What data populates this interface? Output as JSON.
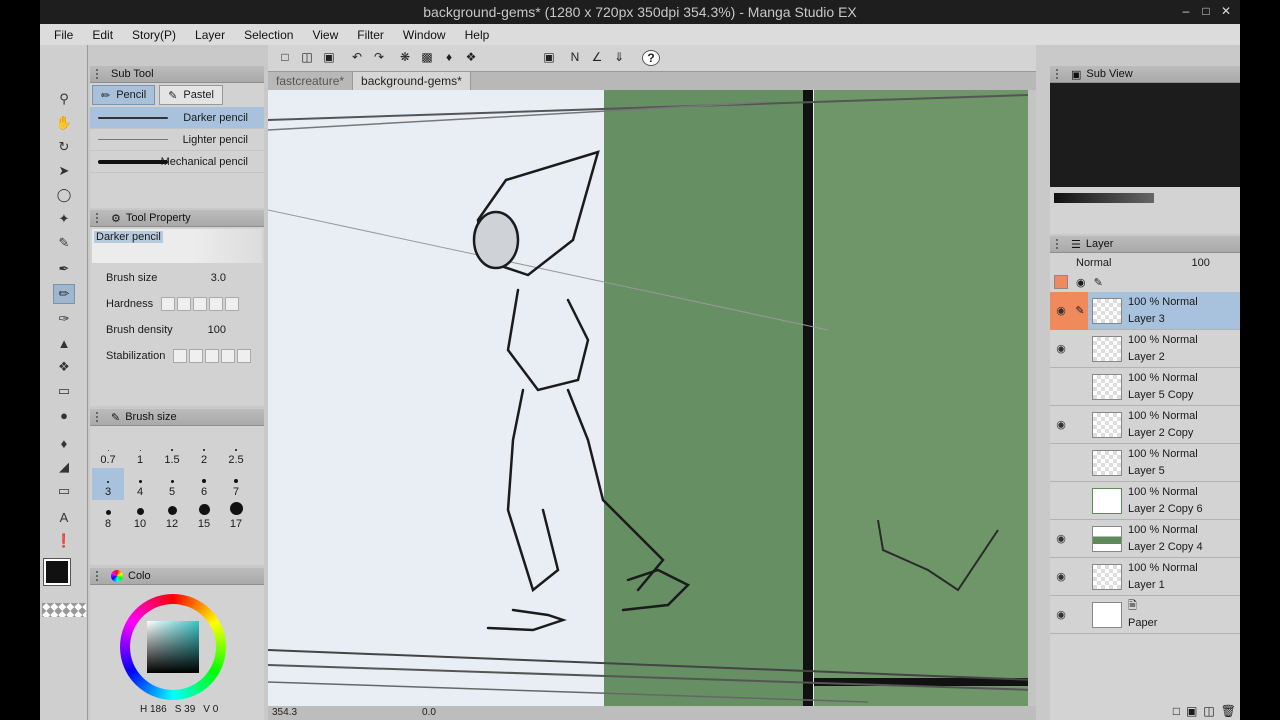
{
  "window": {
    "title": "background-gems* (1280 x 720px 350dpi 354.3%)  - Manga Studio EX"
  },
  "menu": [
    "File",
    "Edit",
    "Story(P)",
    "Layer",
    "Selection",
    "View",
    "Filter",
    "Window",
    "Help"
  ],
  "subtool": {
    "title": "Sub Tool",
    "tabs": [
      "Pencil",
      "Pastel"
    ],
    "items": [
      "Darker pencil",
      "Lighter pencil",
      "Mechanical pencil"
    ]
  },
  "tool_property": {
    "title": "Tool Property",
    "preset": "Darker pencil",
    "brush_size_label": "Brush size",
    "brush_size_value": "3.0",
    "hardness_label": "Hardness",
    "density_label": "Brush density",
    "density_value": "100",
    "stabilization_label": "Stabilization"
  },
  "brush_size_panel": {
    "title": "Brush size",
    "sizes": [
      "0.7",
      "1",
      "1.5",
      "2",
      "2.5",
      "3",
      "4",
      "5",
      "6",
      "7",
      "8",
      "10",
      "12",
      "15",
      "17"
    ]
  },
  "color_panel": {
    "title": "Colo",
    "h": "H 186",
    "s": "S 39",
    "v": "V 0"
  },
  "canvas_tabs": [
    "fastcreature*",
    "background-gems*"
  ],
  "status": {
    "zoom": "354.3",
    "angle": "0.0"
  },
  "subview": {
    "title": "Sub View"
  },
  "layer_panel": {
    "title": "Layer",
    "blend_mode": "Normal",
    "opacity": "100",
    "layers": [
      {
        "mode": "100 %  Normal",
        "name": "Layer 3",
        "visible": true,
        "active": true
      },
      {
        "mode": "100 %  Normal",
        "name": "Layer 2",
        "visible": true,
        "active": false
      },
      {
        "mode": "100 %  Normal",
        "name": "Layer 5 Copy",
        "visible": false,
        "active": false
      },
      {
        "mode": "100 %  Normal",
        "name": "Layer 2 Copy",
        "visible": true,
        "active": false
      },
      {
        "mode": "100 %  Normal",
        "name": "Layer 5",
        "visible": false,
        "active": false
      },
      {
        "mode": "100 %  Normal",
        "name": "Layer 2 Copy 6",
        "visible": false,
        "active": false
      },
      {
        "mode": "100 %  Normal",
        "name": "Layer 2 Copy 4",
        "visible": true,
        "active": false
      },
      {
        "mode": "100 %  Normal",
        "name": "Layer 1",
        "visible": true,
        "active": false
      },
      {
        "mode": "",
        "name": "Paper",
        "visible": true,
        "active": false
      }
    ]
  },
  "colors": {
    "accent_blue": "#a8c1dc",
    "layer_highlight": "#f08a5d",
    "canvas_green": "#5f8a5c",
    "main_color": "#111111",
    "sub_color": "#f07ac8"
  }
}
